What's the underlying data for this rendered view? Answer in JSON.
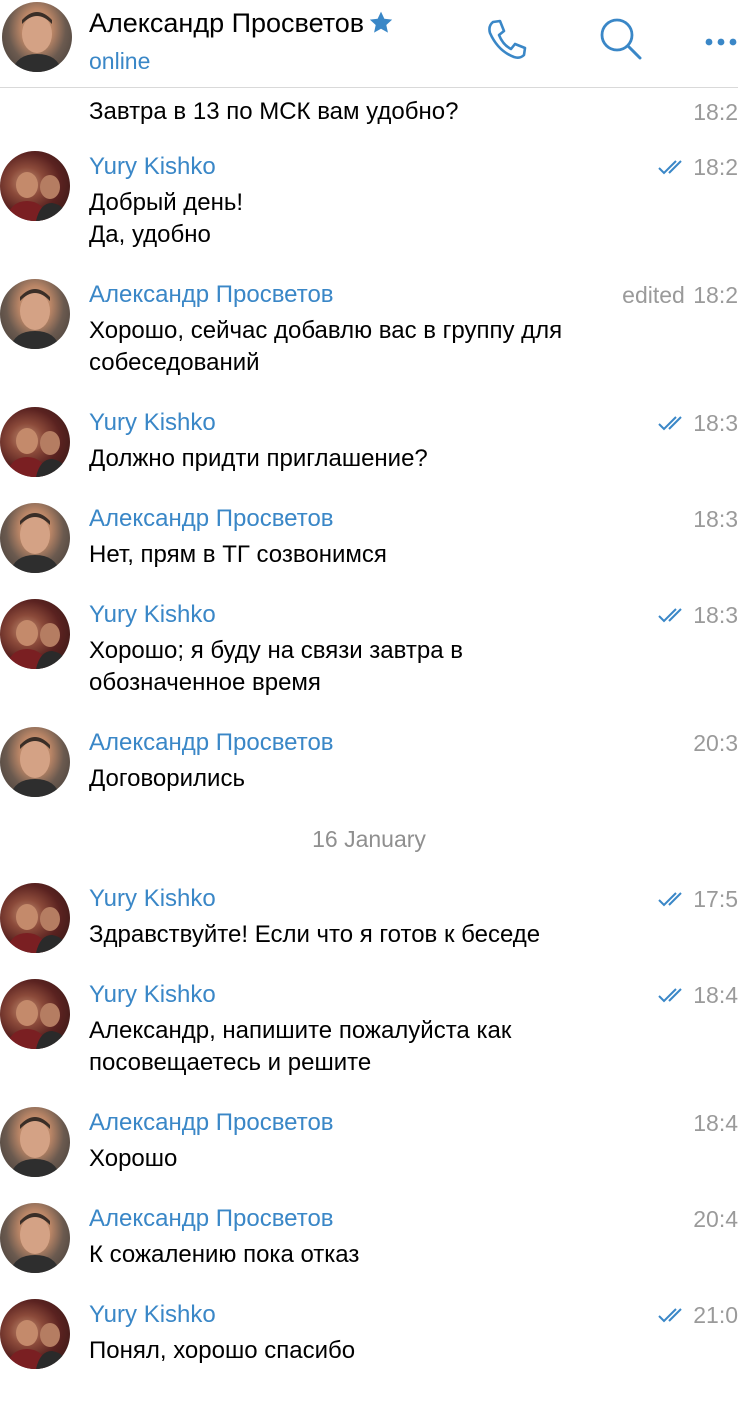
{
  "header": {
    "name": "Александр Просветов",
    "status": "online",
    "icons": [
      "star-icon",
      "phone-icon",
      "search-icon",
      "more-icon"
    ]
  },
  "top_message": {
    "text": "Завтра в 13 по МСК вам удобно?",
    "time": "18:2"
  },
  "date_separator": "16 January",
  "messages": [
    {
      "sender": "Yury Kishko",
      "text": "Добрый день!\nДа, удобно",
      "time": "18:2",
      "read": true
    },
    {
      "sender": "Александр Просветов",
      "text": "Хорошо, сейчас добавлю вас в группу для\nсобеседований",
      "time": "18:2",
      "edited": "edited"
    },
    {
      "sender": "Yury Kishko",
      "text": "Должно придти приглашение?",
      "time": "18:3",
      "read": true
    },
    {
      "sender": "Александр Просветов",
      "text": "Нет, прям в ТГ созвонимся",
      "time": "18:3"
    },
    {
      "sender": "Yury Kishko",
      "text": "Хорошо; я буду на связи завтра в\nобозначенное время",
      "time": "18:3",
      "read": true
    },
    {
      "sender": "Александр Просветов",
      "text": "Договорились",
      "time": "20:3"
    },
    {
      "sender": "Yury Kishko",
      "text": "Здравствуйте! Если что я готов к беседе",
      "time": "17:5",
      "read": true
    },
    {
      "sender": "Yury Kishko",
      "text": "Александр, напишите пожалуйста как\nпосовещаетесь и решите",
      "time": "18:4",
      "read": true
    },
    {
      "sender": "Александр Просветов",
      "text": "Хорошо",
      "time": "18:4"
    },
    {
      "sender": "Александр Просветов",
      "text": "К сожалению пока отказ",
      "time": "20:4"
    },
    {
      "sender": "Yury Kishko",
      "text": "Понял, хорошо спасибо",
      "time": "21:0",
      "read": true
    }
  ],
  "colors": {
    "accent": "#3a87c7",
    "meta": "#9a9a9a",
    "star": "#3a87c7"
  }
}
